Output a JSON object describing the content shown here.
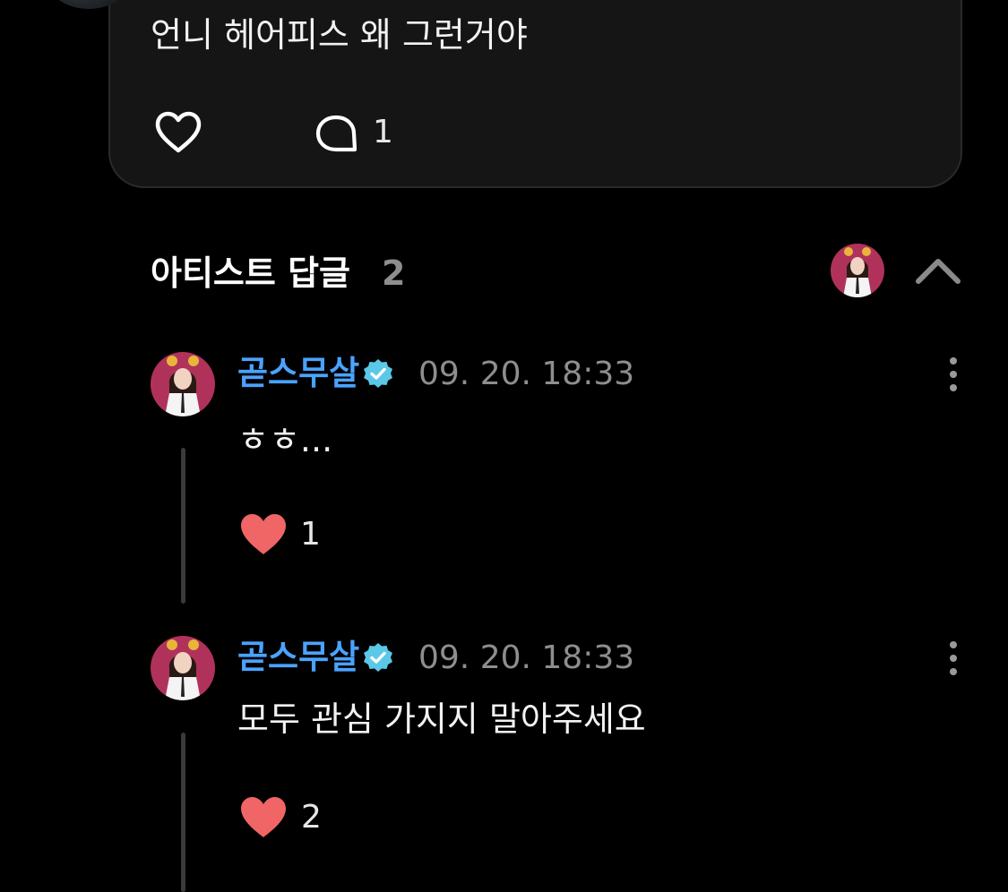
{
  "post": {
    "text": "언니 헤어피스 왜 그런거야",
    "comment_count": "1"
  },
  "artist_replies": {
    "title": "아티스트 답글",
    "count": "2"
  },
  "replies": [
    {
      "author": "곧스무살",
      "timestamp": "09. 20. 18:33",
      "text": "ㅎㅎ...",
      "likes": "1"
    },
    {
      "author": "곧스무살",
      "timestamp": "09. 20. 18:33",
      "text": "모두 관심 가지지 말아주세요",
      "likes": "2"
    }
  ],
  "colors": {
    "background": "#000000",
    "card": "#151515",
    "author": "#4aa3ff",
    "verified_badge": "#5bc8e8",
    "heart_liked": "#f06565",
    "muted_text": "#8e8e8e"
  },
  "icons": {
    "like": "heart-outline-icon",
    "comment": "speech-bubble-icon",
    "collapse": "chevron-up-icon",
    "verified": "verified-badge-icon",
    "more": "more-vertical-icon",
    "liked": "heart-filled-icon"
  }
}
